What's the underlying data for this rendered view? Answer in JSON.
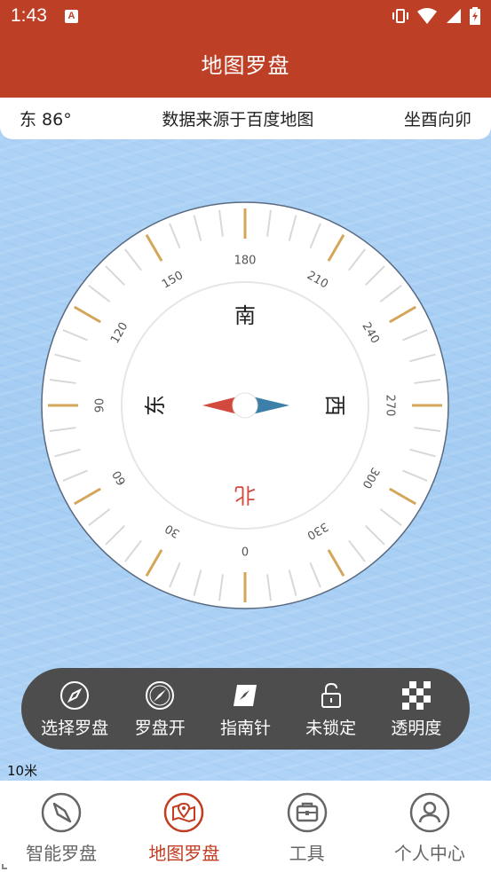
{
  "status": {
    "time": "1:43",
    "indicator": "A"
  },
  "header": {
    "title": "地图罗盘"
  },
  "info_bar": {
    "direction": "东 86°",
    "source": "数据来源于百度地图",
    "orientation": "坐酉向卯"
  },
  "compass": {
    "cardinals": {
      "north": "北",
      "east": "东",
      "south": "南",
      "west": "西"
    },
    "degree_labels": [
      "0",
      "30",
      "60",
      "90",
      "120",
      "150",
      "180",
      "210",
      "240",
      "270",
      "300",
      "330"
    ],
    "heading_degrees": 86,
    "accent_tick_color": "#d4a65a",
    "needle_north_color": "#d14a3d",
    "needle_south_color": "#3c7fa8"
  },
  "toolbar": {
    "items": [
      {
        "label": "选择罗盘",
        "icon": "compass-select-icon"
      },
      {
        "label": "罗盘开",
        "icon": "compass-open-icon"
      },
      {
        "label": "指南针",
        "icon": "needle-icon"
      },
      {
        "label": "未锁定",
        "icon": "unlock-icon"
      },
      {
        "label": "透明度",
        "icon": "transparency-icon"
      }
    ]
  },
  "map": {
    "scale": "10米"
  },
  "nav": {
    "items": [
      {
        "label": "智能罗盘",
        "icon": "compass-icon",
        "active": false
      },
      {
        "label": "地图罗盘",
        "icon": "map-pin-icon",
        "active": true
      },
      {
        "label": "工具",
        "icon": "toolbox-icon",
        "active": false
      },
      {
        "label": "个人中心",
        "icon": "user-icon",
        "active": false
      }
    ],
    "active_color": "#c23c22"
  }
}
